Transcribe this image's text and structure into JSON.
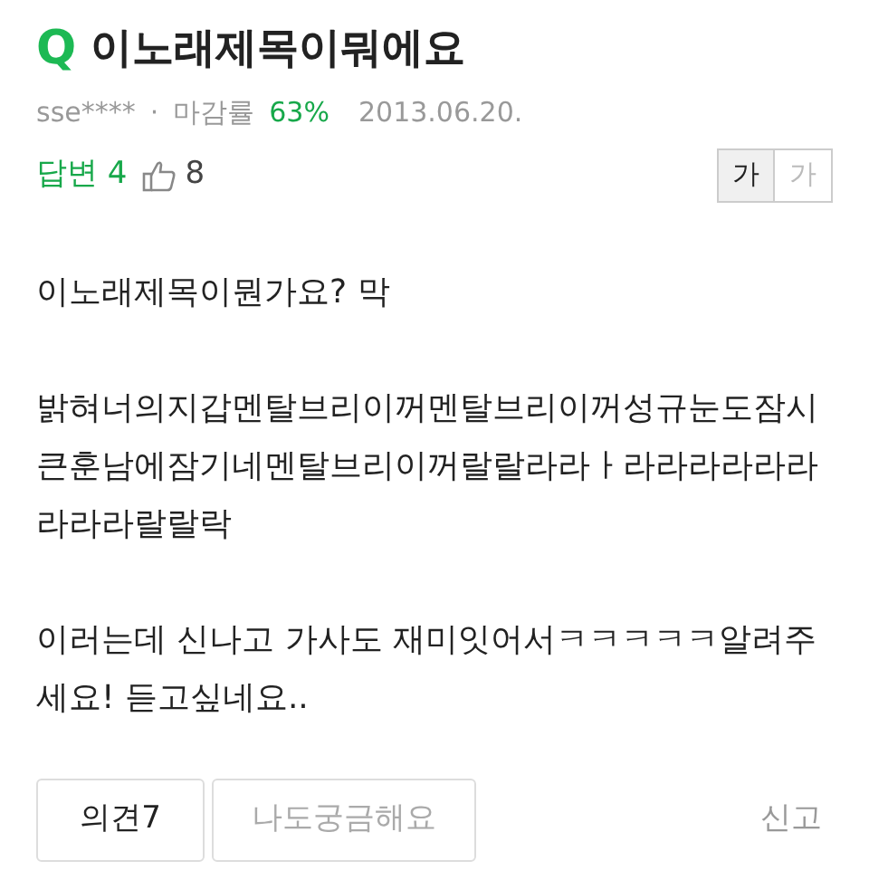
{
  "question": {
    "mark": "Q",
    "title": "이노래제목이뭐에요"
  },
  "meta": {
    "author": "sse****",
    "separator": "·",
    "rate_label": "마감률",
    "rate_value": "63%",
    "date": "2013.06.20."
  },
  "stats": {
    "answers": "답변 4",
    "likes": "8"
  },
  "font_sizes": [
    {
      "label": "가",
      "selected": true
    },
    {
      "label": "가",
      "selected": false
    }
  ],
  "body": [
    "이노래제목이뭔가요? 막",
    "밝혀너의지갑멘탈브리이꺼멘탈브리이꺼성규눈도잠시큰훈남에잠기네멘탈브리이꺼랄랄라라ㅏ라라라라라라라라라랄랄락",
    "이러는데 신나고 가사도 재미잇어서ㅋㅋㅋㅋㅋ알려주세요! 듣고싶네요.."
  ],
  "actions": {
    "opinion": "의견7",
    "curious": "나도궁금해요",
    "report": "신고"
  }
}
